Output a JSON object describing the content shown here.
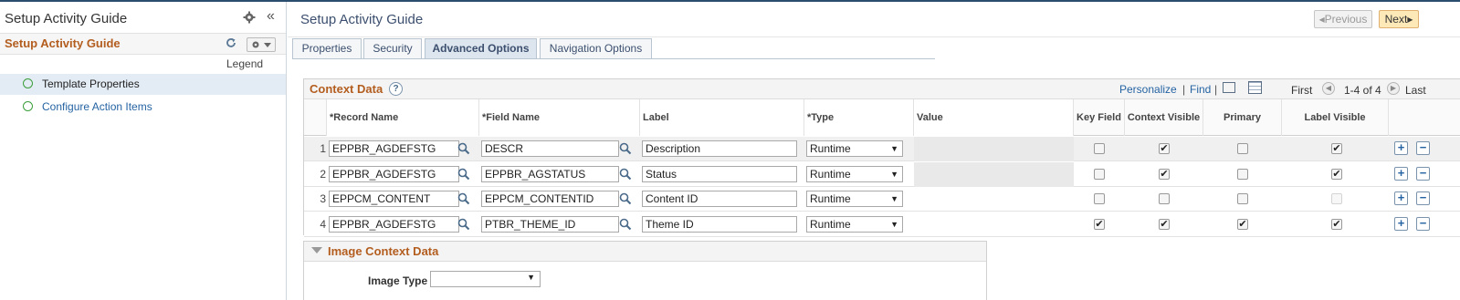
{
  "left_panel": {
    "title": "Setup Activity Guide",
    "header_title": "Setup Activity Guide",
    "legend": "Legend",
    "items": [
      {
        "label": "Template Properties",
        "selected": true
      },
      {
        "label": "Configure Action Items",
        "selected": false
      }
    ]
  },
  "page": {
    "title": "Setup Activity Guide",
    "prev_label": "◂Previous",
    "next_label": "Next▸"
  },
  "tabs": [
    {
      "label": "Properties",
      "active": false
    },
    {
      "label": "Security",
      "active": false
    },
    {
      "label": "Advanced Options",
      "active": true
    },
    {
      "label": "Navigation Options",
      "active": false
    }
  ],
  "grid": {
    "title": "Context Data",
    "help": "?",
    "personalize": "Personalize",
    "find": "Find",
    "separator": "|",
    "first": "First",
    "counter": "1-4 of 4",
    "last": "Last",
    "columns": {
      "record": "*Record Name",
      "field": "*Field Name",
      "label": "Label",
      "type": "*Type",
      "value": "Value",
      "key": "Key Field",
      "context": "Context Visible",
      "primary": "Primary",
      "labelvis": "Label Visible"
    },
    "rows": [
      {
        "num": "1",
        "record": "EPPBR_AGDEFSTG",
        "field": "DESCR",
        "label": "Description",
        "type": "Runtime",
        "key": false,
        "context": true,
        "primary": false,
        "labelvis": true
      },
      {
        "num": "2",
        "record": "EPPBR_AGDEFSTG",
        "field": "EPPBR_AGSTATUS",
        "label": "Status",
        "type": "Runtime",
        "key": false,
        "context": true,
        "primary": false,
        "labelvis": true
      },
      {
        "num": "3",
        "record": "EPPCM_CONTENT",
        "field": "EPPCM_CONTENTID",
        "label": "Content ID",
        "type": "Runtime",
        "key": false,
        "context": false,
        "primary": false,
        "labelvis": false
      },
      {
        "num": "4",
        "record": "EPPBR_AGDEFSTG",
        "field": "PTBR_THEME_ID",
        "label": "Theme ID",
        "type": "Runtime",
        "key": true,
        "context": true,
        "primary": true,
        "labelvis": true
      }
    ]
  },
  "image_section": {
    "title": "Image Context Data",
    "image_type_label": "Image Type",
    "image_type_value": ""
  },
  "colors": {
    "accent_orange": "#b35d1f",
    "link_blue": "#2563a3",
    "title_navy": "#3c4f6e"
  }
}
